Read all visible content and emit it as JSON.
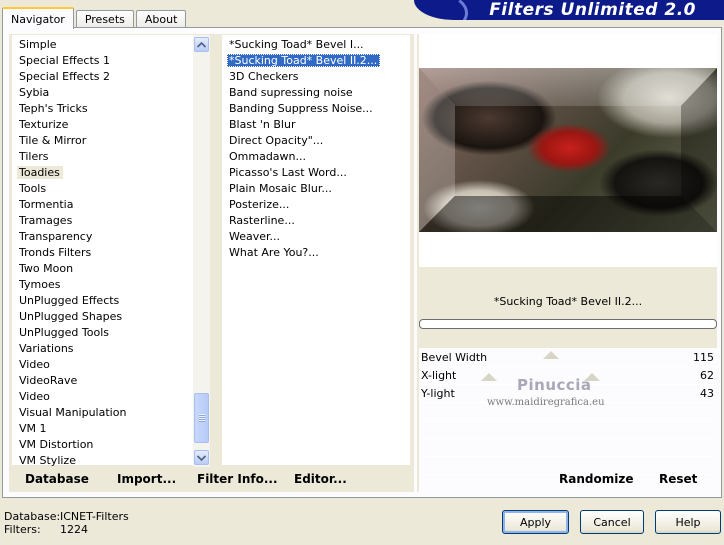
{
  "tabs": [
    {
      "label": "Navigator",
      "active": true
    },
    {
      "label": "Presets",
      "active": false
    },
    {
      "label": "About",
      "active": false
    }
  ],
  "banner": {
    "title": "Filters Unlimited 2.0"
  },
  "categories": {
    "items": [
      "Simple",
      "Special Effects 1",
      "Special Effects 2",
      "Sybia",
      "Teph's Tricks",
      "Texturize",
      "Tile & Mirror",
      "Tilers",
      "Toadies",
      "Tools",
      "Tormentia",
      "Tramages",
      "Transparency",
      "Tronds Filters",
      "Two Moon",
      "Tymoes",
      "UnPlugged Effects",
      "UnPlugged Shapes",
      "UnPlugged Tools",
      "Variations",
      "Video",
      "VideoRave",
      "Video",
      "Visual Manipulation",
      "VM 1",
      "VM Distortion",
      "VM Stylize"
    ],
    "selected_index": 8
  },
  "filters": {
    "items": [
      "*Sucking Toad*  Bevel I...",
      "*Sucking Toad*  Bevel II.2...",
      "3D Checkers",
      "Band supressing noise",
      "Banding Suppress Noise...",
      "Blast 'n Blur",
      "Direct Opacity\"...",
      "Ommadawn...",
      "Picasso's Last Word...",
      "Plain Mosaic Blur...",
      "Posterize...",
      "Rasterline...",
      "Weaver...",
      "What Are You?..."
    ],
    "selected_index": 1
  },
  "left_buttons": {
    "database": "Database",
    "import": "Import...",
    "filter_info": "Filter Info...",
    "editor": "Editor..."
  },
  "preview": {
    "filter_name": "*Sucking Toad*  Bevel II.2..."
  },
  "params": [
    {
      "label": "Bevel Width",
      "value": "115"
    },
    {
      "label": "X-light",
      "value": "62"
    },
    {
      "label": "Y-light",
      "value": "43"
    }
  ],
  "watermark": {
    "name": "Pinuccia",
    "url": "www.maidiregrafica.eu"
  },
  "right_buttons": {
    "randomize": "Randomize",
    "reset": "Reset"
  },
  "status": {
    "database_label": "Database:",
    "database_value": "ICNET-Filters",
    "filters_label": "Filters:",
    "filters_value": "1224"
  },
  "dialog_buttons": {
    "apply": "Apply",
    "cancel": "Cancel",
    "help": "Help"
  },
  "icons": {
    "scroll_up": "chevron-up-icon",
    "scroll_down": "chevron-down-icon"
  }
}
